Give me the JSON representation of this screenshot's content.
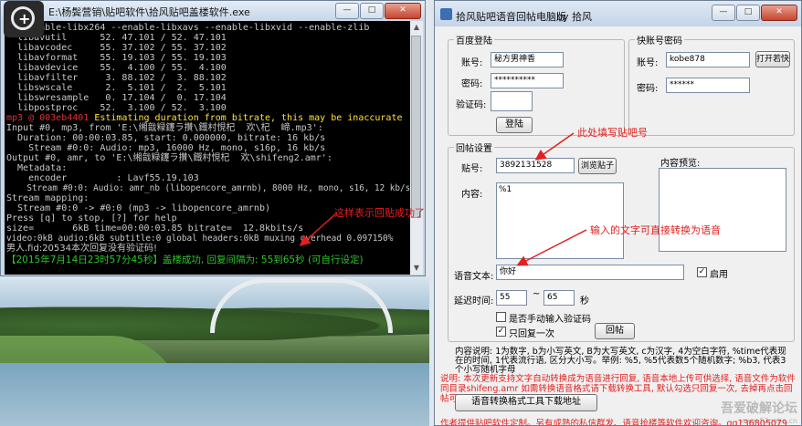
{
  "console": {
    "title": "E:\\杨鬓营销\\贴吧软件\\拾风贴吧盖楼软件.exe",
    "lines": [
      "  --enable-libx264 --enable-libxavs --enable-libxvid --enable-zlib",
      "  libavutil      52. 47.101 / 52. 47.101",
      "  libavcodec     55. 37.102 / 55. 37.102",
      "  libavformat    55. 19.103 / 55. 19.103",
      "  libavdevice    55.  4.100 / 55.  4.100",
      "  libavfilter     3. 88.102 /  3. 88.102",
      "  libswscale      2.  5.101 /  2.  5.101",
      "  libswresample   0. 17.104 /  0. 17.104",
      "  libpostproc    52.  3.100 / 52.  3.100"
    ],
    "warn_prefix": "mp3 @ 003eb4401",
    "warn_text": " Estimating duration from bitrate, this may be inaccurate",
    "lines2": [
      "Input #0, mp3, from 'E:\\缃戠粶鑳ラ攢\\鐡村悓杞  欢\\杞  崹.mp3':",
      "  Duration: 00:00:03.85, start: 0.000000, bitrate: 16 kb/s",
      "    Stream #0:0: Audio: mp3, 16000 Hz, mono, s16p, 16 kb/s",
      "Output #0, amr, to 'E:\\缃戠粶鑳ラ攢\\鐡村悓杞  欢\\shifeng2.amr':",
      "  Metadata:",
      "    encoder         : Lavf55.19.103",
      "    Stream #0:0: Audio: amr_nb (libopencore_amrnb), 8000 Hz, mono, s16, 12 kb/s",
      "Stream mapping:",
      "  Stream #0:0 -> #0:0 (mp3 -> libopencore_amrnb)",
      "Press [q] to stop, [?] for help",
      "size=       6kB time=00:00:03.85 bitrate=  12.8kbits/s",
      "video:0kB audio:6kB subtitle:0 global headers:0kB muxing overhead 0.097150%",
      "男人.fid:20534本次回复没有验证码!"
    ],
    "result_line": "【2015年7月14日23时57分45秒】盖楼成功, 回复间隔为: 55到65秒 (可自行设定)",
    "note": "这样表示回贴成功了"
  },
  "window_buttons": {
    "minimize": "—",
    "maximize": "□",
    "close": "✕"
  },
  "app": {
    "title": "拾风贴吧语音回帖电脑版",
    "by": "by 拾风",
    "baidu_group": {
      "title": "百度登陆",
      "account_label": "账号:",
      "account_value": "秘方男神香",
      "password_label": "密码:",
      "password_value": "**********",
      "captcha_label": "验证码:",
      "captcha_value": "",
      "login_button": "登陆"
    },
    "kuai_group": {
      "title": "快账号密码",
      "account_label": "账号:",
      "account_value": "kobe878",
      "password_label": "密码:",
      "password_value": "******",
      "open_button": "打开若快"
    },
    "reply_group": {
      "title": "回帖设置",
      "post_label": "贴号:",
      "post_value": "3892131528",
      "browse_button": "浏览贴子",
      "preview_label": "内容预览:",
      "content_label": "内容:",
      "content_value": "%1",
      "voice_label": "语音文本:",
      "voice_value": "你好",
      "enable_label": "启用",
      "enable_checked": "✓",
      "delay_label": "延迟时间:",
      "delay_min": "55",
      "delay_sep": "~",
      "delay_max": "65",
      "delay_unit": "秒",
      "manual_captcha_label": "是否手动输入验证码",
      "once_label": "只回复一次",
      "once_checked": "✓",
      "reply_button": "回帖"
    },
    "note_post": "此处填写贴吧号",
    "note_voice": "输入的文字可直接转换为语音",
    "desc": "内容说明: 1为数字, b为小写英文, B为大写英文, c为汉字, 4为空白字符, %time代表现在的时间, 1代表流行语, 区分大小写。举例: %5, %5代表数5个随机数字; %b3, 代表3个小写随机字母",
    "warn": "说明: 本次更新支持文字自动转换成为语音进行回复, 语音本地上传可供选择, 语音文件为软件同目录shifeng.amr 如需转换语音格式请下载转换工具, 默认勾选只回复一次, 去掉再点击回帖可无限回复语音",
    "download_button": "语音转换格式工具下载地址",
    "footer": "作者提供贴吧软件定制。另有成熟的私信群发、语音抢楼等软件欢迎咨询。qq136805079",
    "watermark": "吾爱破解论坛",
    "watermark_url": "www.52pojie.cn"
  }
}
